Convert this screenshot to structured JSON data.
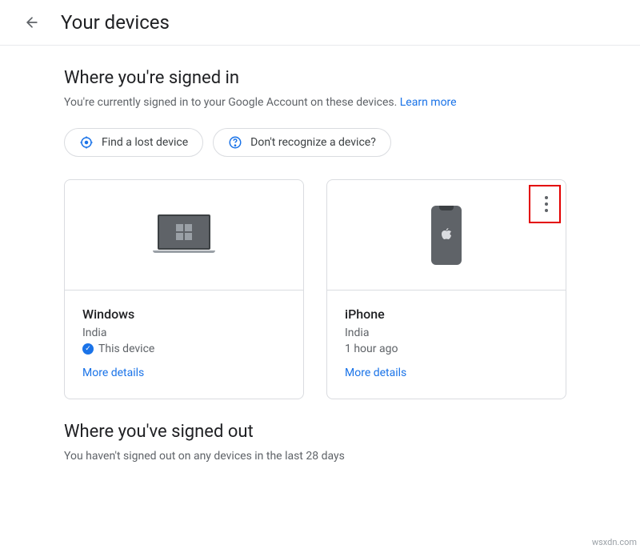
{
  "header": {
    "title": "Your devices"
  },
  "signed_in": {
    "heading": "Where you're signed in",
    "subtitle_prefix": "You're currently signed in to your Google Account on these devices. ",
    "learn_more": "Learn more",
    "find_lost": "Find a lost device",
    "dont_recognize": "Don't recognize a device?"
  },
  "devices": [
    {
      "name": "Windows",
      "location": "India",
      "status": "This device",
      "is_current": true,
      "more": "More details"
    },
    {
      "name": "iPhone",
      "location": "India",
      "status": "1 hour ago",
      "is_current": false,
      "more": "More details"
    }
  ],
  "signed_out": {
    "heading": "Where you've signed out",
    "subtitle": "You haven't signed out on any devices in the last 28 days"
  },
  "watermark": "wsxdn.com"
}
